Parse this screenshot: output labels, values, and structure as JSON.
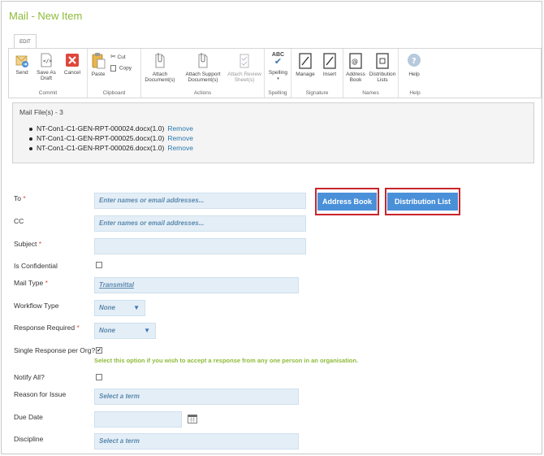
{
  "page_title": "Mail - New Item",
  "tab_label": "EDIT",
  "ribbon": {
    "commit": {
      "label": "Commit",
      "send": "Send",
      "save_as_draft_1": "Save As",
      "save_as_draft_2": "Draft",
      "cancel": "Cancel"
    },
    "clipboard": {
      "label": "Clipboard",
      "paste": "Paste",
      "cut": "Cut",
      "copy": "Copy"
    },
    "actions": {
      "label": "Actions",
      "attach_documents_1": "Attach",
      "attach_documents_2": "Document(s)",
      "attach_support_1": "Attach Support",
      "attach_support_2": "Document(s)",
      "attach_review_1": "Attach Review",
      "attach_review_2": "Sheet(s)"
    },
    "spelling": {
      "label": "Spelling",
      "abc": "ABC",
      "spelling": "Spelling"
    },
    "signature": {
      "label": "Signature",
      "manage": "Manage",
      "insert": "Insert"
    },
    "names": {
      "label": "Names",
      "address_book_1": "Address",
      "address_book_2": "Book",
      "distribution_lists_1": "Distribution",
      "distribution_lists_2": "Lists"
    },
    "help": {
      "label": "Help",
      "help": "Help"
    }
  },
  "mail_files": {
    "title": "Mail File(s) - 3",
    "remove_label": "Remove",
    "items": [
      "NT-Con1-C1-GEN-RPT-000024.docx(1.0)",
      "NT-Con1-C1-GEN-RPT-000025.docx(1.0)",
      "NT-Con1-C1-GEN-RPT-000026.docx(1.0)"
    ]
  },
  "form": {
    "to_label": "To",
    "to_placeholder": "Enter names or email addresses...",
    "cc_label": "CC",
    "cc_placeholder": "Enter names or email addresses...",
    "subject_label": "Subject",
    "subject_value": "",
    "confidential_label": "Is Confidential",
    "mail_type_label": "Mail Type",
    "mail_type_value": "Transmittal",
    "workflow_type_label": "Workflow Type",
    "workflow_type_value": "None",
    "response_required_label": "Response Required",
    "response_required_value": "None",
    "single_response_label": "Single Response per Org?",
    "single_response_hint": "Select this option if you wish to accept a response from any one person in an organisation.",
    "notify_all_label": "Notify All?",
    "reason_label": "Reason for Issue",
    "reason_placeholder": "Select a term",
    "due_date_label": "Due Date",
    "discipline_label": "Discipline",
    "discipline_placeholder": "Select a term",
    "required_marker": "*",
    "address_book_button": "Address Book",
    "distribution_list_button": "Distribution List"
  },
  "colors": {
    "title_green": "#8dbb3a",
    "button_blue": "#4a90d9",
    "highlight_red": "#c9252c",
    "input_bg": "#e4eef7",
    "link_blue": "#2a7ab0"
  }
}
